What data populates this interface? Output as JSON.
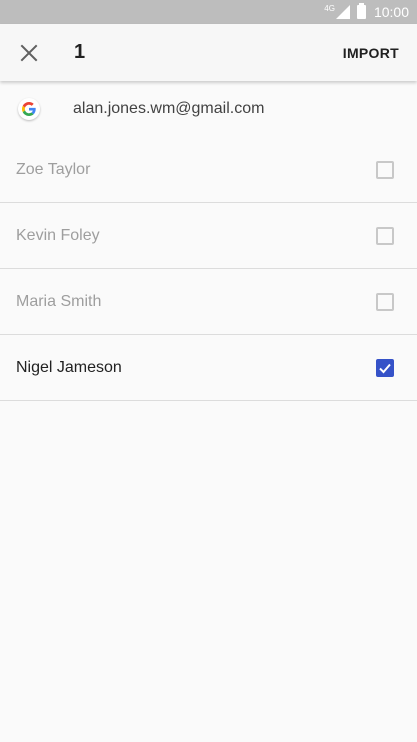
{
  "status_bar": {
    "network": "4G",
    "time": "10:00"
  },
  "app_bar": {
    "close_icon": "close-icon",
    "selected_count": "1",
    "import_label": "IMPORT"
  },
  "account": {
    "icon": "google-icon",
    "email": "alan.jones.wm@gmail.com"
  },
  "contacts": [
    {
      "name": "Zoe Taylor",
      "checked": false
    },
    {
      "name": "Kevin Foley",
      "checked": false
    },
    {
      "name": "Maria Smith",
      "checked": false
    },
    {
      "name": "Nigel Jameson",
      "checked": true
    }
  ],
  "colors": {
    "checkbox_checked": "#3552c8",
    "checkbox_unchecked": "#c8c8c8",
    "status_bar": "#bdbdbd"
  }
}
